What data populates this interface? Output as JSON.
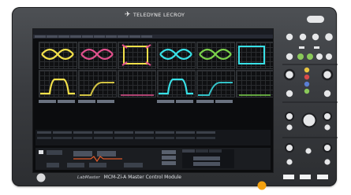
{
  "device": {
    "brand": "TELEDYNE LECROY",
    "caption_prefix": "LabMaster",
    "caption_model": "MCM-Zi-A",
    "caption_name": "Master Control Module"
  },
  "colors": {
    "bezel": "#3a3c40",
    "screen": "#0b0c0e",
    "trace_yellow": "#f2e04a",
    "trace_pink": "#e0508c",
    "trace_cyan": "#38e0e6",
    "trace_green": "#7ad14a",
    "led_green": "#8ac95a",
    "led_yellow": "#e8c440",
    "led_red": "#d84a4a",
    "led_blue": "#5a7fd4",
    "power_orange": "#f3a10f"
  }
}
